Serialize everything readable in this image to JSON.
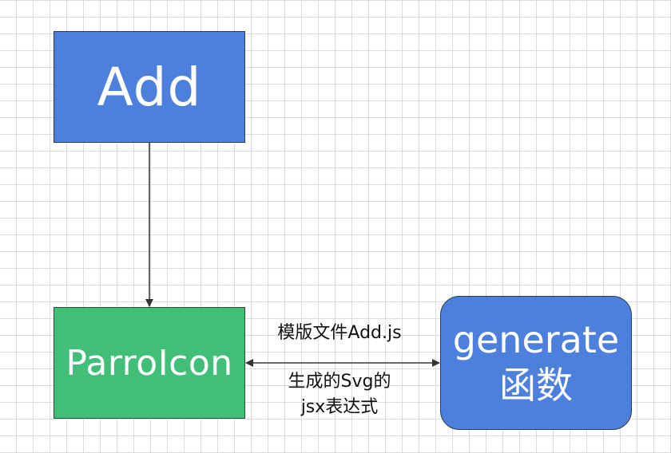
{
  "nodes": {
    "add": {
      "label": "Add"
    },
    "parrot_icon": {
      "label": "ParroIcon"
    },
    "generate": {
      "line1": "generate",
      "line2": "函数"
    }
  },
  "edges": {
    "parrot_generate": {
      "label_top": "模版文件Add.js",
      "label_bottom_line1": "生成的Svg的",
      "label_bottom_line2": "jsx表达式"
    }
  },
  "colors": {
    "add_fill": "#4d80dd",
    "parrot_fill": "#41bf79",
    "generate_fill": "#4d80dd",
    "edge_stroke": "#333333"
  }
}
